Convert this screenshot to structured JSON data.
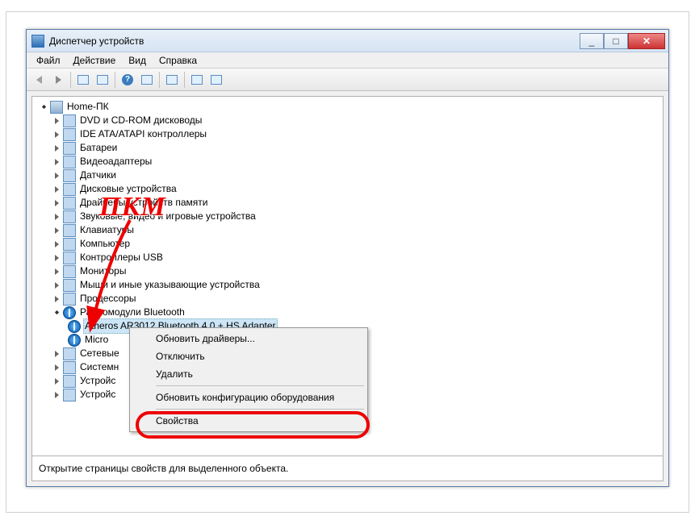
{
  "window": {
    "title": "Диспетчер устройств"
  },
  "window_buttons": {
    "min": "_",
    "max": "□",
    "close": "✕"
  },
  "menu": {
    "file": "Файл",
    "action": "Действие",
    "view": "Вид",
    "help": "Справка"
  },
  "tree": {
    "root": "Home-ПК",
    "categories": [
      {
        "label": "DVD и CD-ROM дисководы",
        "icon": "disc"
      },
      {
        "label": "IDE ATA/ATAPI контроллеры",
        "icon": "ide"
      },
      {
        "label": "Батареи",
        "icon": "battery"
      },
      {
        "label": "Видеоадаптеры",
        "icon": "display"
      },
      {
        "label": "Датчики",
        "icon": "sensor"
      },
      {
        "label": "Дисковые устройства",
        "icon": "hdd"
      },
      {
        "label": "Драйверы устройств памяти",
        "icon": "memory"
      },
      {
        "label": "Звуковые, видео и игровые устройства",
        "icon": "sound"
      },
      {
        "label": "Клавиатуры",
        "icon": "keyboard"
      },
      {
        "label": "Компьютер",
        "icon": "computer"
      },
      {
        "label": "Контроллеры USB",
        "icon": "usb"
      },
      {
        "label": "Мониторы",
        "icon": "monitor"
      },
      {
        "label": "Мыши и иные указывающие устройства",
        "icon": "mouse"
      },
      {
        "label": "Процессоры",
        "icon": "cpu"
      },
      {
        "label": "Радиомодули Bluetooth",
        "icon": "bluetooth",
        "expanded": true,
        "children": [
          {
            "label": "Atheros AR3012 Bluetooth 4.0 + HS Adapter",
            "icon": "bt",
            "selected": true
          },
          {
            "label": "Microsoft Bluetooth Enumerator",
            "icon": "bt",
            "truncated": "Micro"
          }
        ]
      },
      {
        "label": "Сетевые адаптеры",
        "icon": "network",
        "truncated": "Сетевые"
      },
      {
        "label": "Системные устройства",
        "icon": "system",
        "truncated": "Системн"
      },
      {
        "label": "Устройства HID (Human Interface Devices)",
        "icon": "hid",
        "truncated": "Устройс"
      },
      {
        "label": "Устройства обработки изображений",
        "icon": "imaging",
        "truncated": "Устройс"
      }
    ]
  },
  "context_menu": {
    "update_drivers": "Обновить драйверы...",
    "disable": "Отключить",
    "delete": "Удалить",
    "scan_hw": "Обновить конфигурацию оборудования",
    "properties": "Свойства"
  },
  "annotation": {
    "rmb": "ПКМ"
  },
  "statusbar": {
    "text": "Открытие страницы свойств для выделенного объекта."
  }
}
